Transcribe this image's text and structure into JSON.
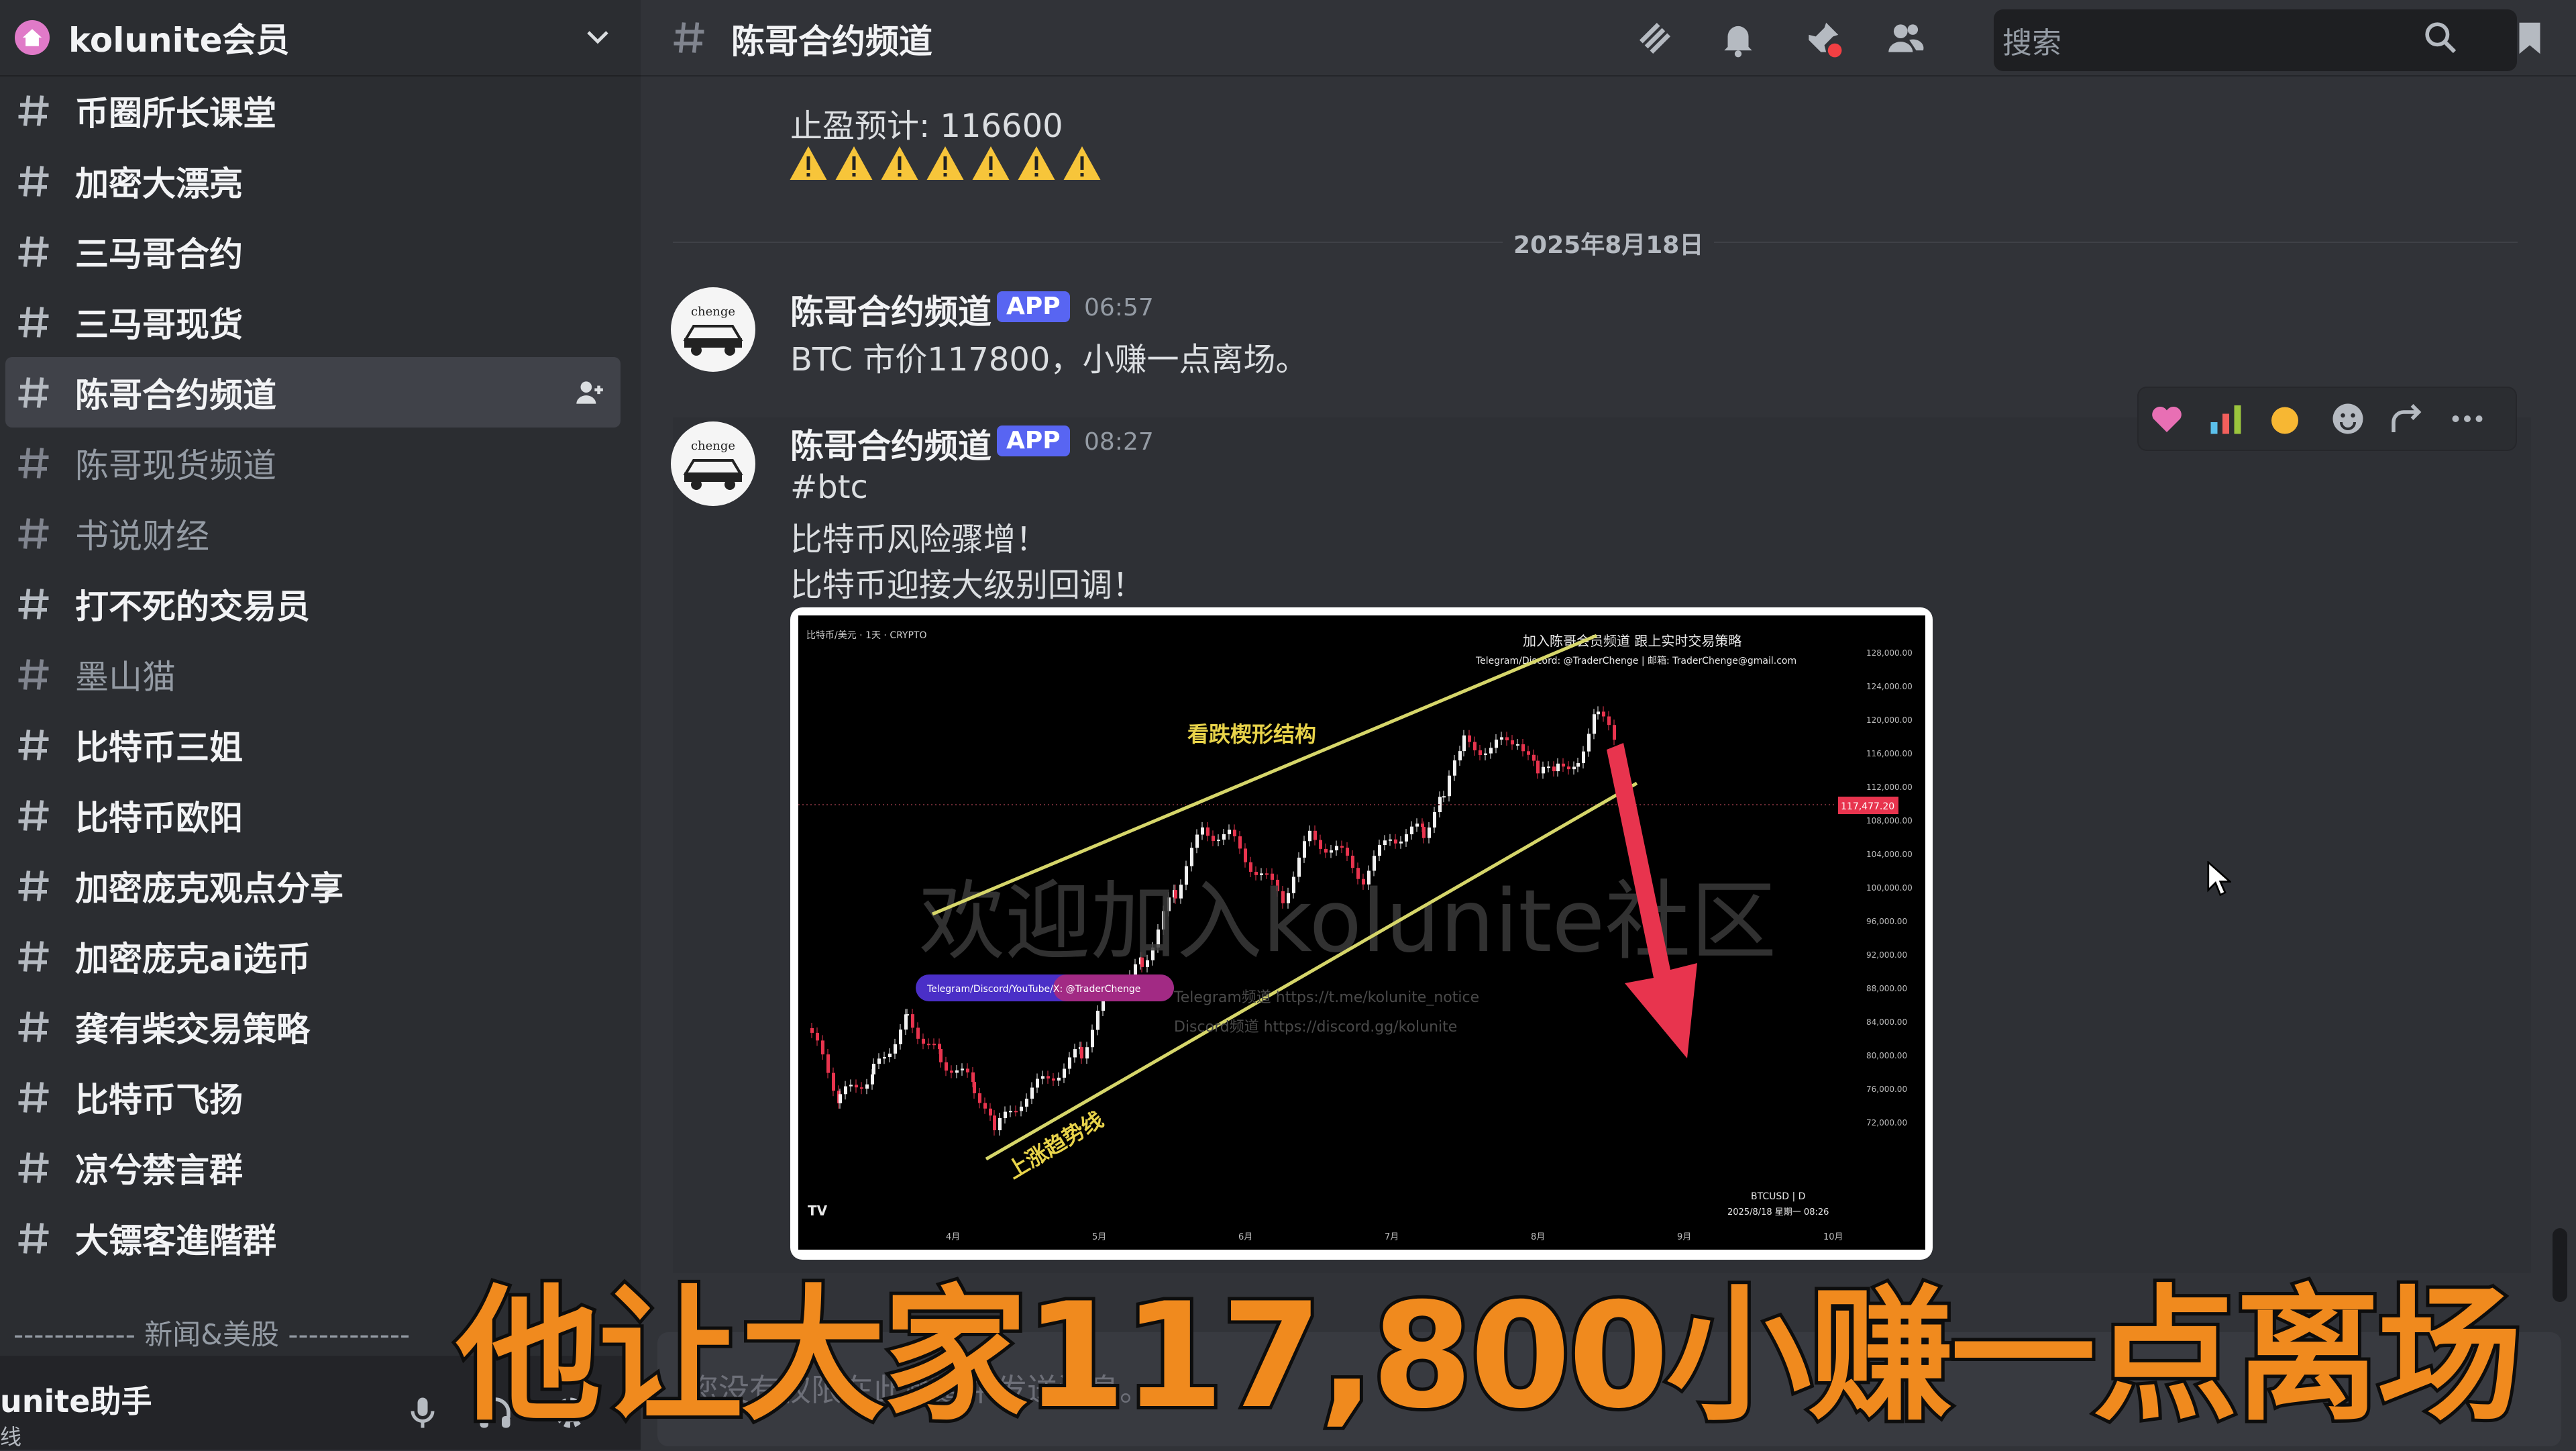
{
  "server": {
    "name": "kolunite会员"
  },
  "sidebar": {
    "channels": [
      {
        "label": "币圈所长课堂"
      },
      {
        "label": "加密大漂亮"
      },
      {
        "label": "三马哥合约"
      },
      {
        "label": "三马哥现货"
      },
      {
        "label": "陈哥合约频道",
        "active": true
      },
      {
        "label": "陈哥现货频道",
        "muted": true
      },
      {
        "label": "书说财经",
        "muted": true
      },
      {
        "label": "打不死的交易员"
      },
      {
        "label": "墨山猫",
        "muted": true
      },
      {
        "label": "比特币三姐"
      },
      {
        "label": "比特币欧阳"
      },
      {
        "label": "加密庞克观点分享"
      },
      {
        "label": "加密庞克ai选币"
      },
      {
        "label": "龚有柴交易策略"
      },
      {
        "label": "比特币飞扬"
      },
      {
        "label": "凉兮禁言群"
      },
      {
        "label": "大镖客進階群"
      }
    ],
    "category": "------------ 新闻&美股 ------------",
    "user": {
      "name": "unite助手",
      "status": "线"
    }
  },
  "header": {
    "channel_title": "陈哥合约频道",
    "search_placeholder": "搜索"
  },
  "messages": {
    "prev_line": "止盈预计: 116600",
    "date_divider": "2025年8月18日",
    "items": [
      {
        "author": "陈哥合约频道",
        "badge": "APP",
        "time": "06:57",
        "avatar_text": "chenge",
        "lines": [
          "BTC 市价117800，小赚一点离场。"
        ]
      },
      {
        "author": "陈哥合约频道",
        "badge": "APP",
        "time": "08:27",
        "avatar_text": "chenge",
        "lines": [
          "#btc",
          "比特币风险骤增！",
          "比特币迎接大级别回调！"
        ]
      }
    ]
  },
  "attachment": {
    "header_left": "比特币/美元 · 1天 · CRYPTO",
    "promo_line1": "加入陈哥会员频道  跟上实时交易策略",
    "promo_line2": "Telegram/Discord: @TraderChenge  |  邮箱: TraderChenge@gmail.com",
    "pattern_label": "看跌楔形结构",
    "trendline_label": "上涨趋势线",
    "watermark": "欢迎加入kolunite社区",
    "social_pill": "Telegram/Discord/YouTube/X: @TraderChenge",
    "link1": "Telegram频道  https://t.me/kolunite_notice",
    "link2": "Discord频道  https://discord.gg/kolunite",
    "price_tag": "117,477.20",
    "symbol": "BTCUSD | D",
    "date_stamp": "2025/8/18 星期一 08:26",
    "logo": "TV",
    "y_ticks": [
      "128,000.00",
      "124,000.00",
      "120,000.00",
      "116,000.00",
      "112,000.00",
      "108,000.00",
      "104,000.00",
      "100,000.00",
      "96,000.00",
      "92,000.00",
      "88,000.00",
      "84,000.00",
      "80,000.00",
      "76,000.00",
      "72,000.00"
    ],
    "x_ticks": [
      "4月",
      "5月",
      "6月",
      "7月",
      "8月",
      "9月",
      "10月"
    ]
  },
  "input": {
    "placeholder": "您没有权限在此频道中发送消息。"
  },
  "caption": {
    "text": "他让大家117,800小赚一点离场"
  },
  "colors": {
    "accent": "#5865f2",
    "caption": "#f08a1e",
    "trendline": "#d6d66a",
    "arrow": "#e8344e"
  }
}
